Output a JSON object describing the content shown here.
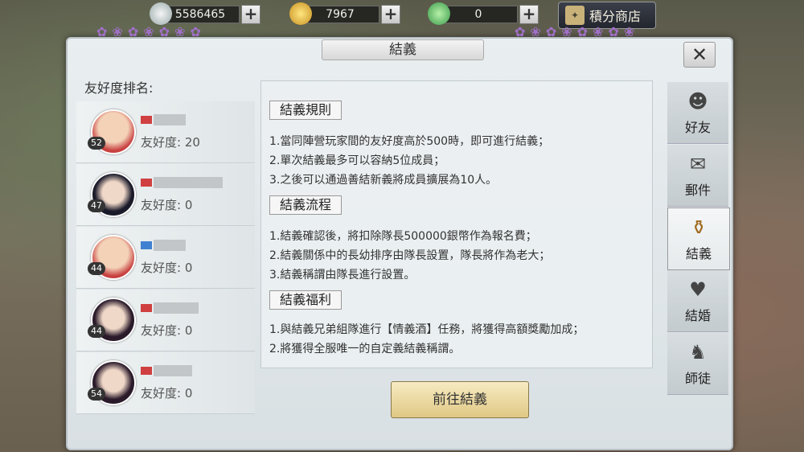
{
  "currency": [
    {
      "value": "5586465",
      "icon": "silver-coin-icon"
    },
    {
      "value": "7967",
      "icon": "gold-coin-icon"
    },
    {
      "value": "0",
      "icon": "jade-ingot-icon"
    }
  ],
  "shop": {
    "label": "積分商店"
  },
  "panel": {
    "title": "結義"
  },
  "left": {
    "header": "友好度排名:",
    "rows": [
      {
        "level": "52",
        "friend": "友好度: 20"
      },
      {
        "level": "47",
        "friend": "友好度: 0"
      },
      {
        "level": "44",
        "friend": "友好度: 0"
      },
      {
        "level": "44",
        "friend": "友好度: 0"
      },
      {
        "level": "54",
        "friend": "友好度: 0"
      }
    ]
  },
  "sections": [
    {
      "title": "結義規則",
      "lines": [
        "1.當同陣營玩家間的友好度高於500時，即可進行結義；",
        "2.單次結義最多可以容納5位成員；",
        "3.之後可以通過善結新義將成員擴展為10人。"
      ]
    },
    {
      "title": "結義流程",
      "lines": [
        "1.結義確認後，將扣除隊長500000銀幣作為報名費；",
        "2.結義關係中的長幼排序由隊長設置，隊長將作為老大；",
        "3.結義稱謂由隊長進行設置。"
      ]
    },
    {
      "title": "結義福利",
      "lines": [
        "1.與結義兄弟組隊進行【情義酒】任務，將獲得高額獎勵加成；",
        "2.將獲得全服唯一的自定義結義稱謂。"
      ]
    }
  ],
  "button": "前往結義",
  "tabs": [
    {
      "label": "好友",
      "icon": "friend-icon"
    },
    {
      "label": "郵件",
      "icon": "mail-icon"
    },
    {
      "label": "結義",
      "icon": "wine-jar-icon"
    },
    {
      "label": "結婚",
      "icon": "marriage-icon"
    },
    {
      "label": "師徒",
      "icon": "master-icon"
    }
  ],
  "colors": {
    "accent": "#e0c885",
    "panel": "#e9eef0"
  }
}
